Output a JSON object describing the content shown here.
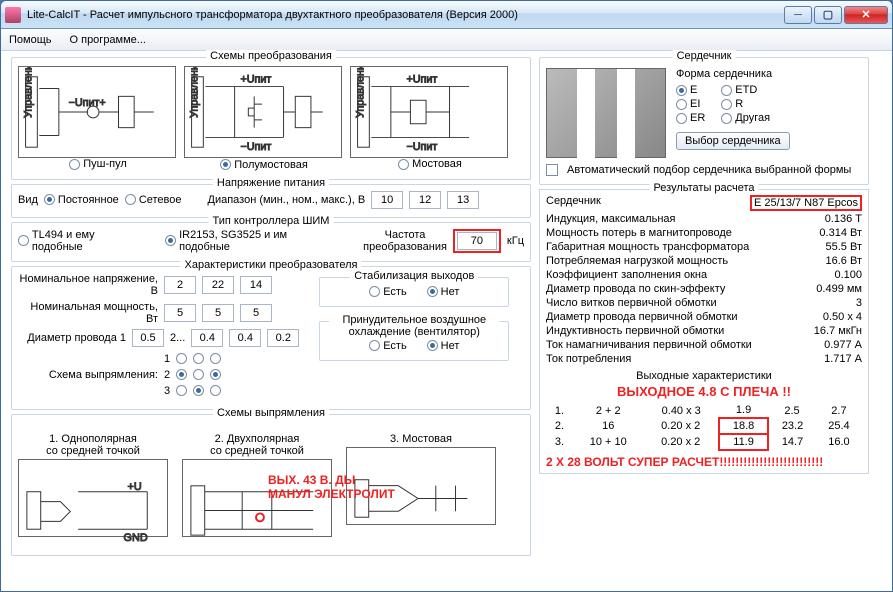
{
  "window": {
    "title": "Lite-CalcIT - Расчет импульсного трансформатора двухтактного преобразователя (Версия 2000)"
  },
  "menu": {
    "help": "Помощь",
    "about": "О программе..."
  },
  "schemes": {
    "title": "Схемы преобразования",
    "push": "Пуш-пул",
    "half": "Полумостовая",
    "full": "Мостовая"
  },
  "supply": {
    "title": "Напряжение питания",
    "kind": "Вид",
    "dc": "Постоянное",
    "ac": "Сетевое",
    "range": "Диапазон (мин., ном., макс.), В",
    "vmin": "10",
    "vnom": "12",
    "vmax": "13"
  },
  "pwm": {
    "title": "Тип контроллера ШИМ",
    "tl494": "TL494 и ему подобные",
    "ir2153": "IR2153, SG3525 и им подобные",
    "freq_lbl": "Частота\nпреобразования",
    "freq": "70",
    "freq_unit": "кГц"
  },
  "conv": {
    "title": "Характеристики преобразователя",
    "nomV": "Номинальное напряжение, В",
    "nomP": "Номинальная мощность, Вт",
    "wireD": "Диаметр провода 1",
    "rectScheme": "Схема выпрямления:",
    "v1": "2",
    "v2": "22",
    "v3": "14",
    "p1": "5",
    "p2": "5",
    "p3": "5",
    "d0": "0.5",
    "d1": "0.4",
    "d2": "0.4",
    "d3": "0.2",
    "stab_title": "Стабилизация выходов",
    "yes": "Есть",
    "no": "Нет",
    "cool_title": "Принудительное воздушное охлаждение (вентилятор)"
  },
  "rect": {
    "title": "Схемы выпрямления",
    "r1": "1. Однополярная\nсо средней точкой",
    "r2": "2. Двухполярная\nсо средней точкой",
    "r3": "3. Мостовая"
  },
  "core": {
    "title": "Сердечник",
    "shape": "Форма сердечника",
    "E": "E",
    "ETD": "ETD",
    "EI": "EI",
    "R": "R",
    "ER": "ER",
    "Other": "Другая",
    "btn": "Выбор сердечника",
    "auto": "Автоматический подбор сердечника выбранной формы"
  },
  "res": {
    "title": "Результаты расчета",
    "corelabel": "Сердечник",
    "coreval": "E 25/13/7 N87 Epcos",
    "rows": [
      [
        "Индукция, максимальная",
        "0.136 Т"
      ],
      [
        "Мощность потерь в магнитопроводе",
        "0.314 Вт"
      ],
      [
        "Габаритная мощность трансформатора",
        "55.5 Вт"
      ],
      [
        "Потребляемая нагрузкой мощность",
        "16.6 Вт"
      ],
      [
        "Коэффициент заполнения окна",
        "0.100"
      ],
      [
        "Диаметр провода по скин-эффекту",
        "0.499 мм"
      ],
      [
        "Число витков первичной обмотки",
        "3"
      ],
      [
        "Диаметр провода первичной обмотки",
        "0.50 x 4"
      ],
      [
        "Индуктивность первичной обмотки",
        "16.7 мкГн"
      ],
      [
        "Ток намагничивания первичной обмотки",
        "0.977 А"
      ],
      [
        "Ток потребления",
        "1.717 А"
      ]
    ],
    "outtitle": "Выходные характеристики",
    "outrows": [
      [
        "1.",
        "2 + 2",
        "0.40 x 3",
        "1.9",
        "2.5",
        "2.7"
      ],
      [
        "2.",
        "16",
        "0.20 x 2",
        "18.8",
        "23.2",
        "25.4"
      ],
      [
        "3.",
        "10 + 10",
        "0.20 x 2",
        "11.9",
        "14.7",
        "16.0"
      ]
    ]
  },
  "annot": {
    "a1": "ВЫХ. 43 В. ДЫ\nМАНУЛ ЭЛЕКТРОЛИТ",
    "a2": "ВЫХОДНОЕ 4.8 С ПЛЕЧА !!",
    "a3": "2 Х 28 ВОЛЬТ  СУПЕР РАСЧЕТ!!!!!!!!!!!!!!!!!!!!!!!!!!"
  }
}
